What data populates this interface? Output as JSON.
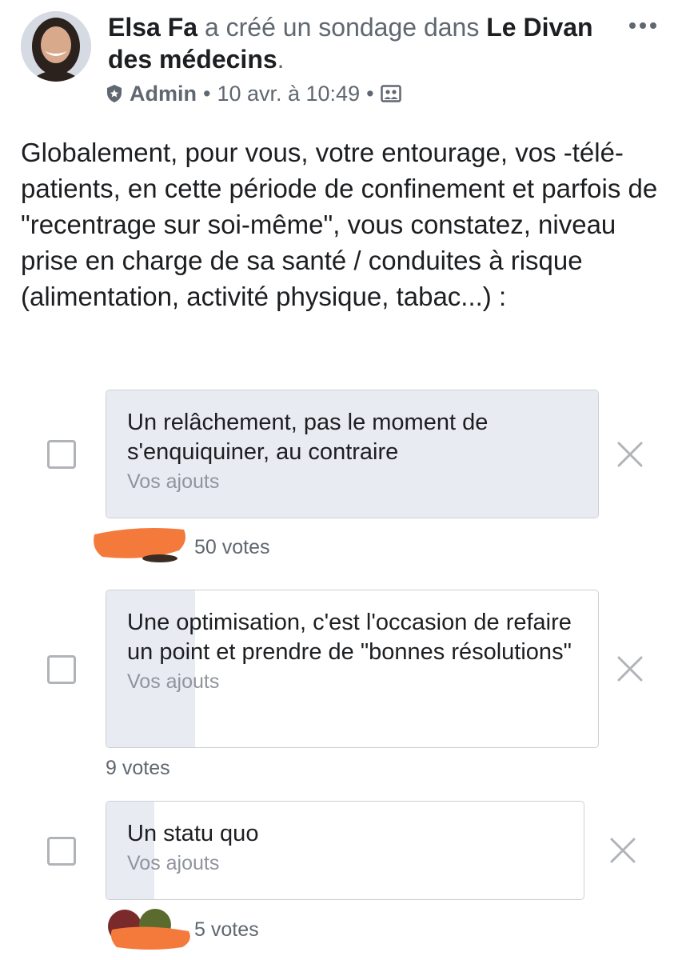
{
  "post": {
    "author": "Elsa Fa",
    "action": "a créé un sondage dans",
    "group": "Le Divan des médecins",
    "period": ".",
    "role": "Admin",
    "separator": "•",
    "timestamp": "10 avr. à 10:49",
    "avatar_icon": "person-avatar",
    "role_icon": "shield-icon",
    "audience_icon": "group-audience-icon",
    "more_icon": "more-dots-icon"
  },
  "question": "Globalement, pour vous, votre entourage, vos -télé-patients, en cette période de confinement et parfois de \"recentrage sur soi-même\", vous constatez, niveau prise en charge de sa santé / conduites à risque (alimentation, activité physique, tabac...) :",
  "options": [
    {
      "text": "Un relâchement, pas le moment de s'enquiquiner, au contraire",
      "sub": "Vos ajouts",
      "votes": "50 votes",
      "share": 1.0
    },
    {
      "text": "Une optimisation, c'est l'occasion de refaire un point et prendre de \"bonnes résolutions\"",
      "sub": "Vos ajouts",
      "votes": "9 votes",
      "share": 0.18
    },
    {
      "text": "Un statu quo",
      "sub": "Vos ajouts",
      "votes": "5 votes",
      "share": 0.1
    }
  ],
  "colors": {
    "fill": "#e9ebf3",
    "border": "#ccd0d5",
    "muted": "#606770",
    "redaction": "#f47a3c"
  }
}
